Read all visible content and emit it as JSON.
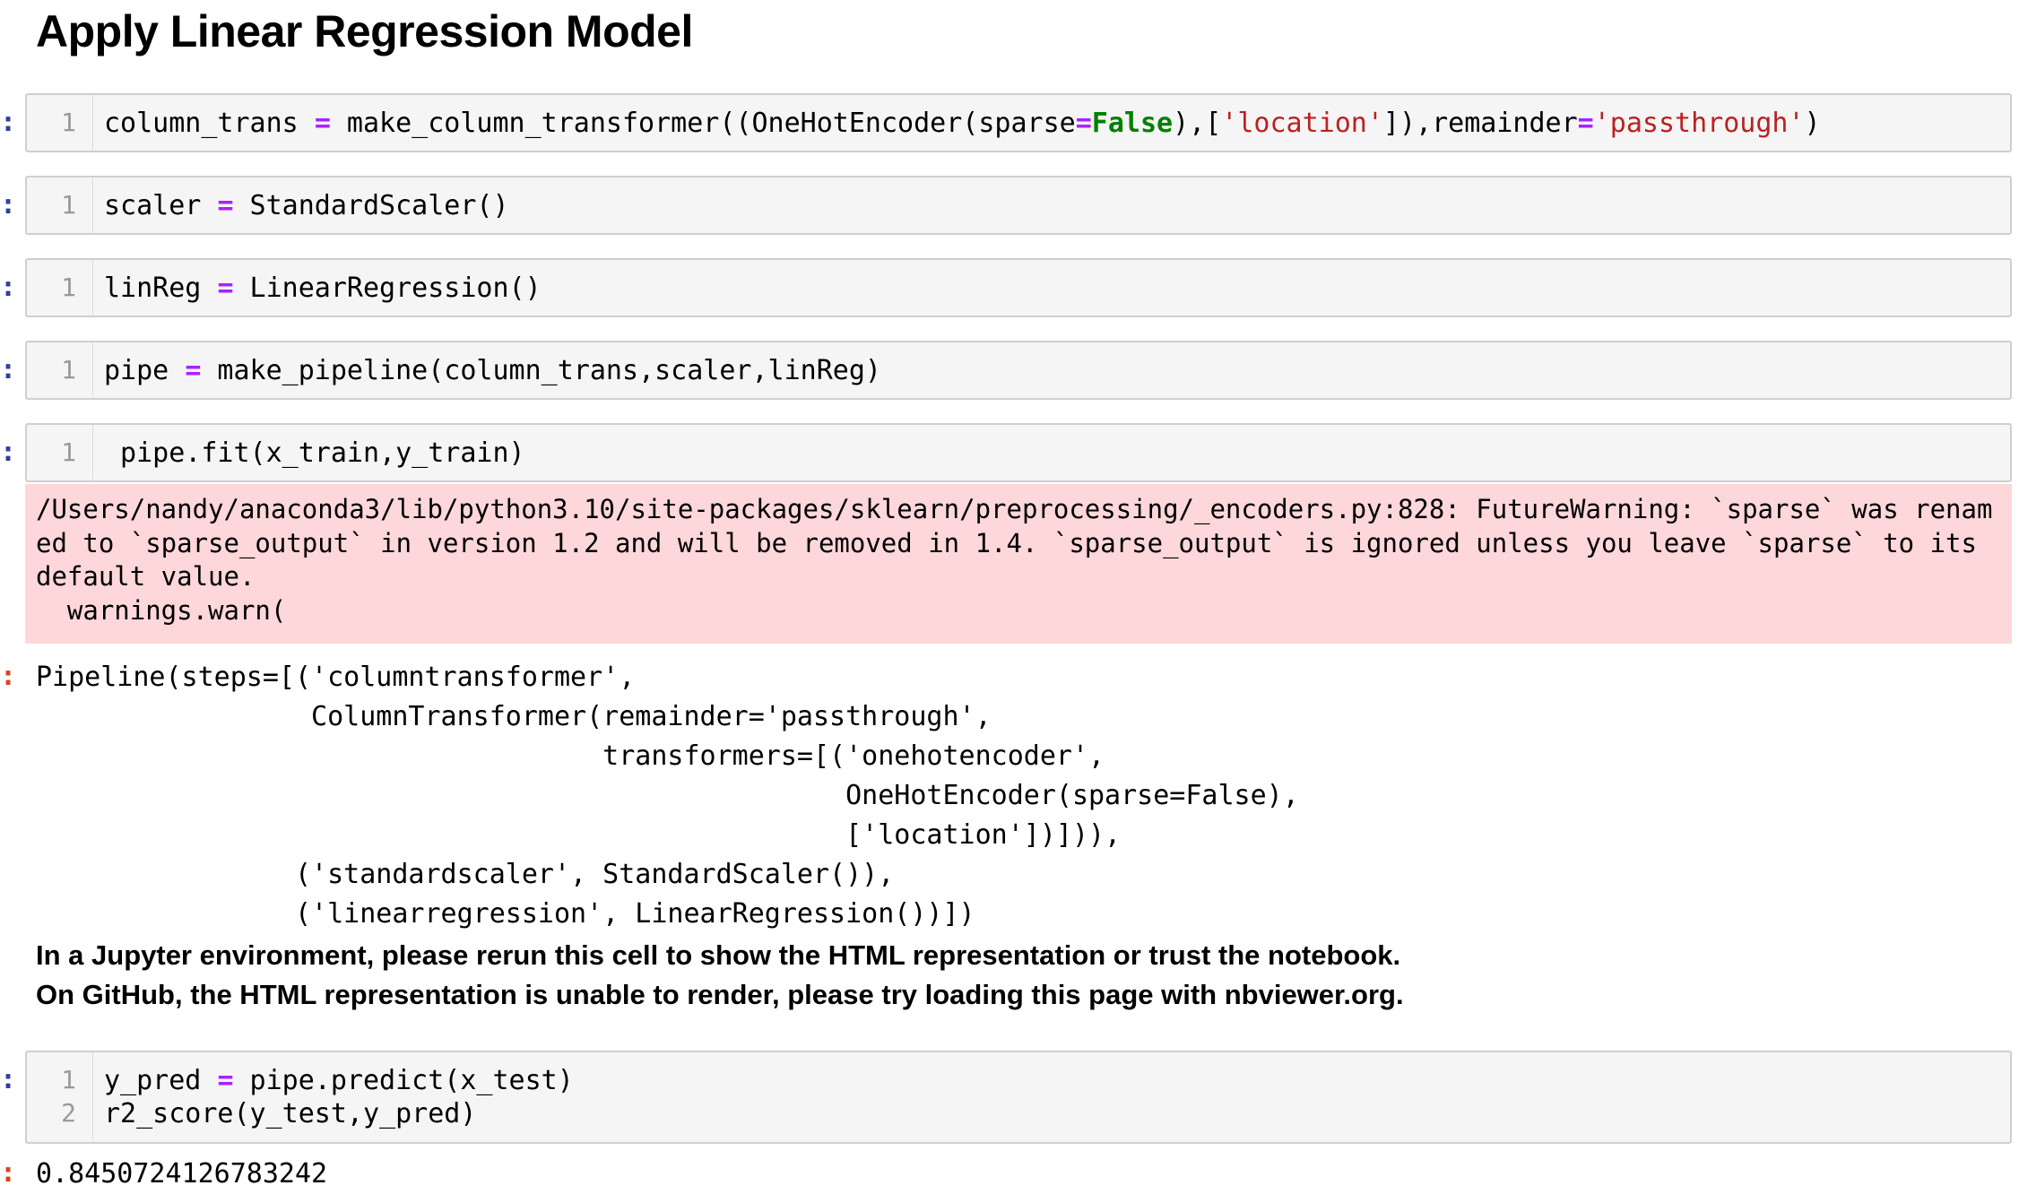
{
  "heading": "Apply Linear Regression Model",
  "prompt_in": ":",
  "prompt_out": ":",
  "cells": [
    {
      "line_numbers": [
        "1"
      ]
    },
    {
      "line_numbers": [
        "1"
      ]
    },
    {
      "line_numbers": [
        "1"
      ]
    },
    {
      "line_numbers": [
        "1"
      ]
    },
    {
      "line_numbers": [
        "1"
      ]
    },
    {
      "line_numbers": [
        "1",
        "2"
      ]
    }
  ],
  "code": {
    "c1": {
      "a": "column_trans ",
      "op1": "=",
      "b": " make_column_transformer((OneHotEncoder(sparse",
      "op2": "=",
      "kw": "False",
      "c": "),[",
      "s1": "'location'",
      "d": "]),remainder",
      "op3": "=",
      "s2": "'passthrough'",
      "e": ")"
    },
    "c2": {
      "a": "scaler ",
      "op": "=",
      "b": " StandardScaler()"
    },
    "c3": {
      "a": "linReg ",
      "op": "=",
      "b": " LinearRegression()"
    },
    "c4": {
      "a": "pipe ",
      "op": "=",
      "b": " make_pipeline(column_trans,scaler,linReg)"
    },
    "c5": {
      "a": " pipe.fit(x_train,y_train)"
    },
    "c6": {
      "l1a": "y_pred ",
      "l1op": "=",
      "l1b": " pipe.predict(x_test)",
      "l2": "r2_score(y_test,y_pred)"
    }
  },
  "stderr_text": "/Users/nandy/anaconda3/lib/python3.10/site-packages/sklearn/preprocessing/_encoders.py:828: FutureWarning: `sparse` was renamed to `sparse_output` in version 1.2 and will be removed in 1.4. `sparse_output` is ignored unless you leave `sparse` to its default value.\n  warnings.warn(",
  "pipeline_repr": "Pipeline(steps=[('columntransformer',\n                 ColumnTransformer(remainder='passthrough',\n                                   transformers=[('onehotencoder',\n                                                  OneHotEncoder(sparse=False),\n                                                  ['location'])])),\n                ('standardscaler', StandardScaler()),\n                ('linearregression', LinearRegression())])",
  "note_line1": "In a Jupyter environment, please rerun this cell to show the HTML representation or trust the notebook.",
  "note_line2": "On GitHub, the HTML representation is unable to render, please try loading this page with nbviewer.org.",
  "r2_output": "0.8450724126783242"
}
